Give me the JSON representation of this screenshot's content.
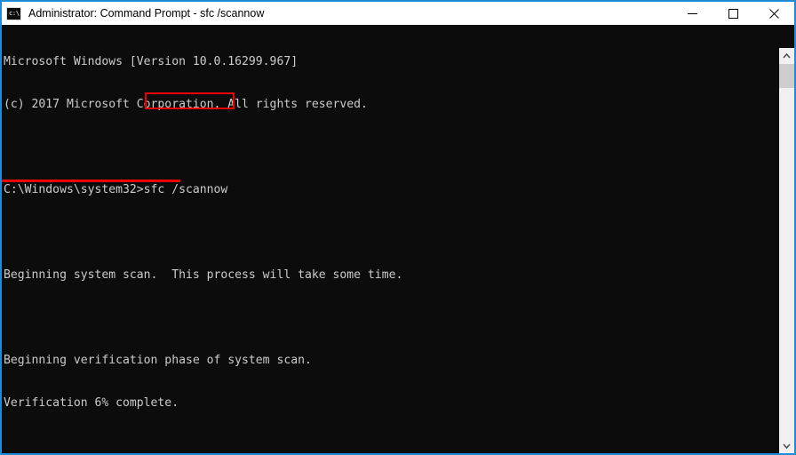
{
  "window": {
    "title": "Administrator: Command Prompt - sfc /scannow",
    "icon": "console-icon",
    "icon_glyph": "c:\\.",
    "border_color": "#1e8bd8",
    "titlebar_background": "#ffffff",
    "console_background": "#0c0c0c",
    "console_foreground": "#cccccc",
    "annotation_color": "#ee0000"
  },
  "controls": {
    "minimize_label": "Minimize",
    "maximize_label": "Maximize",
    "close_label": "Close"
  },
  "console": {
    "lines": [
      "Microsoft Windows [Version 10.0.16299.967]",
      "(c) 2017 Microsoft Corporation. All rights reserved.",
      "",
      "C:\\Windows\\system32>sfc /scannow",
      "",
      "Beginning system scan.  This process will take some time.",
      "",
      "Beginning verification phase of system scan.",
      "Verification 6% complete."
    ],
    "prompt_path": "C:\\Windows\\system32>",
    "typed_command": "sfc /scannow",
    "os_name": "Microsoft Windows",
    "os_version": "[Version 10.0.16299.967]",
    "copyright": "(c) 2017 Microsoft Corporation. All rights reserved.",
    "scan_start_message": "Beginning system scan.  This process will take some time.",
    "verification_phase_message": "Beginning verification phase of system scan.",
    "verification_progress_message": "Verification 6% complete.",
    "verification_percent": "6%"
  },
  "scrollbar": {
    "up_arrow": "chevron-up-icon",
    "down_arrow": "chevron-down-icon",
    "thumb_position": "top"
  }
}
